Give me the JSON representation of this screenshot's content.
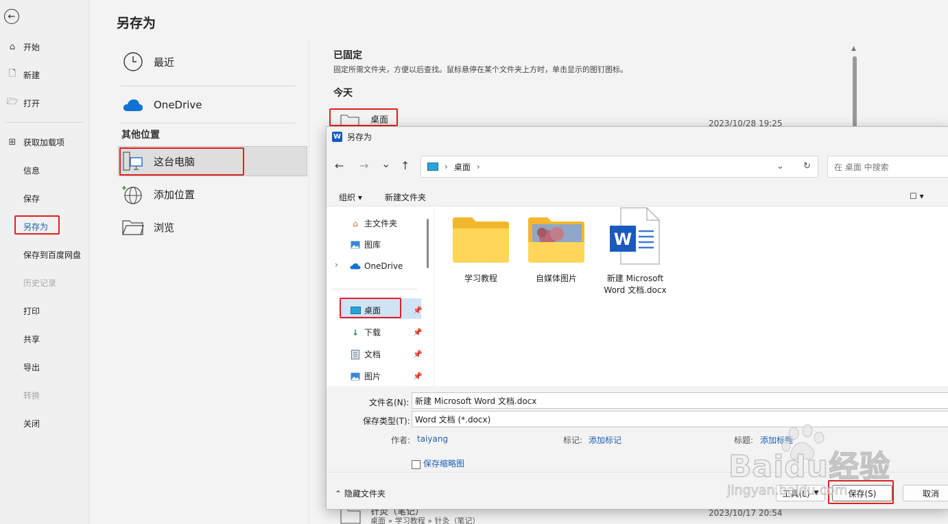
{
  "sidebar": {
    "back_label": "←",
    "items": [
      {
        "label": "开始",
        "icon": "home-icon"
      },
      {
        "label": "新建",
        "icon": "new-doc-icon"
      },
      {
        "label": "打开",
        "icon": "folder-open-icon"
      },
      {
        "label": "获取加载项",
        "icon": "addins-icon"
      },
      {
        "label": "信息"
      },
      {
        "label": "保存"
      },
      {
        "label": "另存为"
      },
      {
        "label": "保存到百度网盘"
      },
      {
        "label": "历史记录"
      },
      {
        "label": "打印"
      },
      {
        "label": "共享"
      },
      {
        "label": "导出"
      },
      {
        "label": "转换"
      },
      {
        "label": "关闭"
      }
    ]
  },
  "main": {
    "title": "另存为",
    "locations": {
      "recent": "最近",
      "onedrive": "OneDrive",
      "other_group": "其他位置",
      "this_pc": "这台电脑",
      "add_place": "添加位置",
      "browse": "浏览"
    }
  },
  "right_pane": {
    "pinned_heading": "已固定",
    "pinned_desc": "固定所需文件夹，方便以后查找。鼠标悬停在某个文件夹上方时，单击显示的图钉图标。",
    "today_heading": "今天",
    "desktop_row": {
      "name": "桌面",
      "date": "2023/10/28 19:25"
    },
    "bottom_row": {
      "name": "针灸（笔记）",
      "path": "桌面 » 学习教程 » 针灸（笔记）",
      "date": "2023/10/17 20:54"
    }
  },
  "dialog": {
    "title": "另存为",
    "nav": {
      "back": "←",
      "forward": "→",
      "recent": "⌄",
      "up": "↑"
    },
    "address": {
      "segments": [
        "桌面"
      ],
      "refresh": "↻",
      "dropdown": "⌄"
    },
    "search_placeholder": "在 桌面 中搜索",
    "toolbar": {
      "organize": "组织 ▾",
      "new_folder": "新建文件夹",
      "view": "☐ ▾"
    },
    "nav_pane": {
      "items": [
        {
          "label": "主文件夹",
          "icon": "home-icon"
        },
        {
          "label": "图库",
          "icon": "gallery-icon"
        },
        {
          "label": "OneDrive",
          "icon": "cloud-icon",
          "expander": "›"
        },
        {
          "label": "桌面",
          "icon": "desktop-icon",
          "pinned": true
        },
        {
          "label": "下载",
          "icon": "download-icon",
          "pinned": true
        },
        {
          "label": "文档",
          "icon": "document-icon",
          "pinned": true
        },
        {
          "label": "图片",
          "icon": "picture-icon",
          "pinned": true
        }
      ]
    },
    "files": [
      {
        "name": "学习教程",
        "type": "folder"
      },
      {
        "name": "自媒体图片",
        "type": "folder-image"
      },
      {
        "name": "新建 Microsoft Word 文档.docx",
        "type": "word"
      }
    ],
    "form": {
      "filename_label": "文件名(N):",
      "filename_value": "新建 Microsoft Word 文档.docx",
      "filetype_label": "保存类型(T):",
      "filetype_value": "Word 文档 (*.docx)",
      "author_label": "作者:",
      "author_value": "taiyang",
      "tags_label": "标记:",
      "tags_value": "添加标记",
      "title_label": "标题:",
      "title_value": "添加标题",
      "thumbnail_label": "保存缩略图"
    },
    "footer": {
      "hide_folders": "隐藏文件夹",
      "tools": "工具(L)",
      "save": "保存(S)",
      "cancel": "取消"
    }
  },
  "watermark": {
    "text": "Baidu经验",
    "sub": "jingyan.baidu.com"
  },
  "colors": {
    "accent": "#1b5fb3",
    "highlight_box": "#e02020",
    "selection": "#cfe3f7"
  }
}
